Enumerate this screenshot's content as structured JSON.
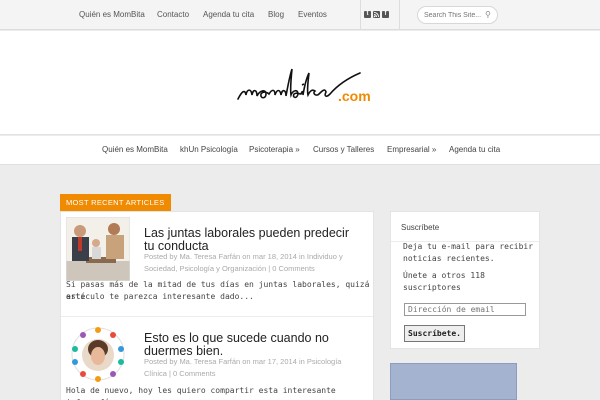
{
  "topbar": {
    "links": [
      "Quién es MomBita",
      "Contacto",
      "Agenda tu cita",
      "Blog",
      "Eventos"
    ],
    "social_icons": [
      "twitter-icon",
      "rss-icon",
      "facebook-icon"
    ],
    "search_placeholder": "Search This Site..."
  },
  "logo": {
    "script": "mombita",
    "suffix": ".com"
  },
  "mainnav": {
    "items": [
      {
        "label": "Quién es MomBita"
      },
      {
        "label": "khUn Psicología"
      },
      {
        "label": "Psicoterapia »"
      },
      {
        "label": "Cursos y Talleres"
      },
      {
        "label": "Empresarial »"
      },
      {
        "label": "Agenda tu cita"
      }
    ]
  },
  "section": {
    "label": "MOST RECENT ARTICLES"
  },
  "articles": [
    {
      "title_line1": "Las juntas laborales pueden predecir",
      "title_line2": "tu conducta",
      "meta_line1": "Posted by Ma. Teresa Farfán on mar 18, 2014 in Individuo y",
      "meta_line2": "Sociedad, Psicología y Organización | 0 Comments",
      "excerpt_line1": "Si pasas más de la mitad de tus días en juntas laborales, quizá este",
      "excerpt_line2": "artículo te parezca interesante dado..."
    },
    {
      "title_line1": "Esto es lo que sucede cuando no",
      "title_line2": "duermes bien.",
      "meta_line1": "Posted by Ma. Teresa Farfán on mar 17, 2014 in Psicología",
      "meta_line2": "Clínica | 0 Comments",
      "excerpt_line1": "Hola de nuevo, hoy les quiero compartir esta interesante infografía"
    }
  ],
  "sidebar": {
    "widget_title": "Suscríbete",
    "text_line1": "Deja tu e-mail para recibir",
    "text_line2": "noticias recientes.",
    "count_line1": "Únete a otros 118",
    "count_line2": "suscriptores",
    "email_placeholder": "Dirección de email",
    "button_label": "Suscríbete."
  },
  "colors": {
    "accent": "#f08a00",
    "ad": "#a4b3cf"
  }
}
